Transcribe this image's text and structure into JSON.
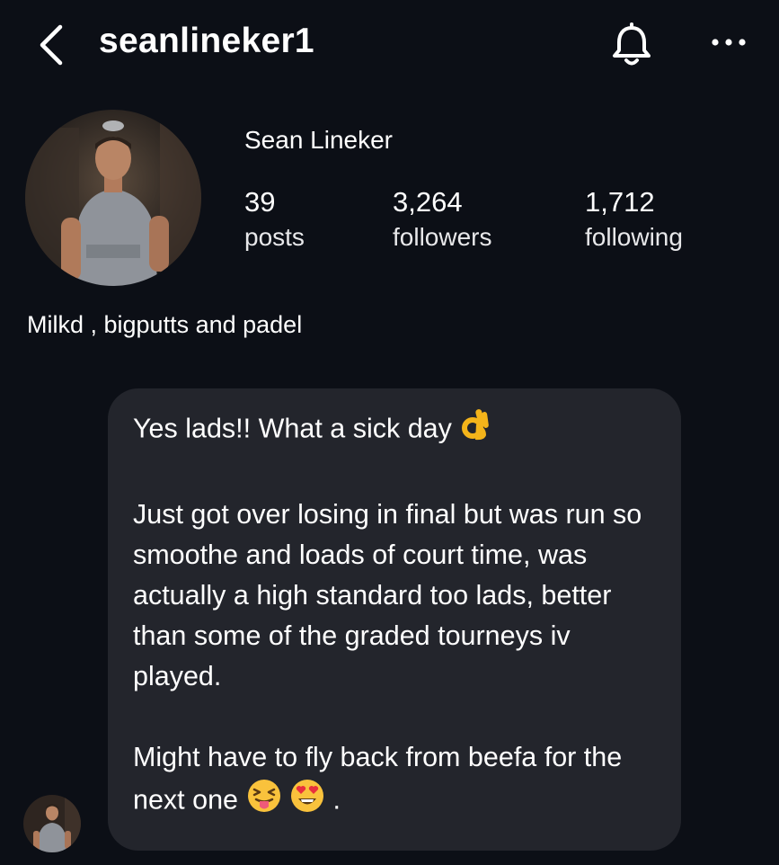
{
  "header": {
    "username": "seanlineker1",
    "back_icon": "chevron-left-icon",
    "bell_icon": "bell-icon",
    "more_icon": "more-horizontal-icon"
  },
  "profile": {
    "display_name": "Sean Lineker",
    "stats": [
      {
        "value": "39",
        "label": "posts"
      },
      {
        "value": "3,264",
        "label": "followers"
      },
      {
        "value": "1,712",
        "label": "following"
      }
    ],
    "bio": "Milkd , bigputts and padel"
  },
  "message": {
    "paragraphs": [
      "Yes lads!! What a sick day",
      "Just got over losing in final but was run so smoothe and loads of court time, was actually a high standard too lads, better than some of the graded tourneys iv played.",
      "Might have to fly back from beefa for the next one"
    ],
    "trailing_punctuation": ".",
    "emojis": [
      "ok-hand-icon",
      "squinting-tongue-face-icon",
      "heart-eyes-face-icon"
    ]
  },
  "colors": {
    "background": "#0c0f16",
    "bubble": "#23252c",
    "text": "#ffffff"
  }
}
